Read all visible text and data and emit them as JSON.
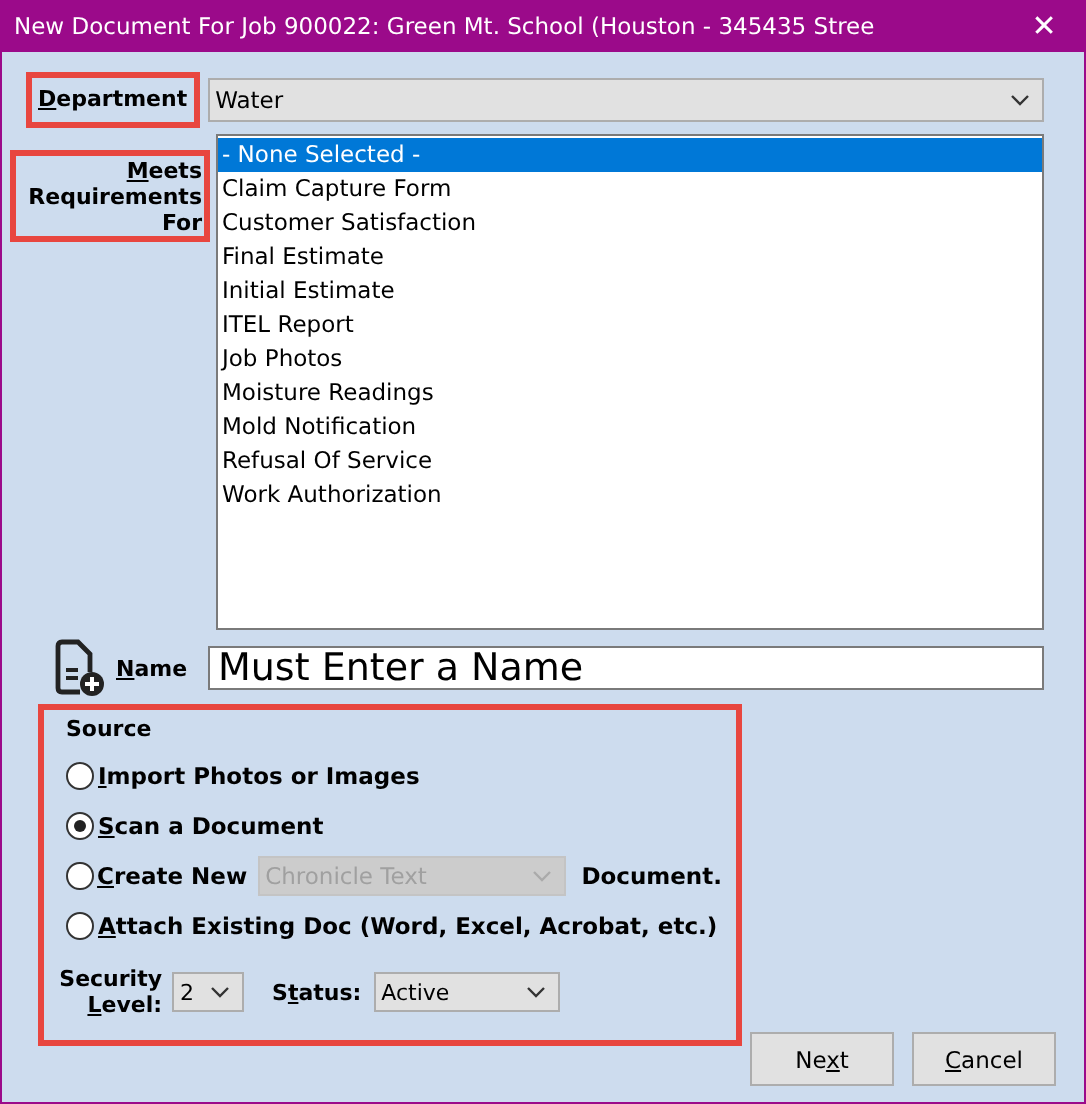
{
  "window": {
    "title": "New Document For Job 900022: Green Mt. School (Houston - 345435 Stree",
    "close": "✕"
  },
  "department": {
    "label": {
      "key": "D",
      "post": "epartment"
    },
    "highlighted": true,
    "value": "Water"
  },
  "meets_requirements": {
    "label": {
      "key": "M",
      "post": "eets Requirements For"
    },
    "highlighted": true,
    "items": [
      {
        "label": "- None Selected -",
        "selected": true
      },
      {
        "label": "Claim Capture Form",
        "selected": false
      },
      {
        "label": "Customer Satisfaction",
        "selected": false
      },
      {
        "label": "Final Estimate",
        "selected": false
      },
      {
        "label": "Initial Estimate",
        "selected": false
      },
      {
        "label": "ITEL Report",
        "selected": false
      },
      {
        "label": "Job Photos",
        "selected": false
      },
      {
        "label": "Moisture Readings",
        "selected": false
      },
      {
        "label": "Mold Notification",
        "selected": false
      },
      {
        "label": "Refusal Of Service",
        "selected": false
      },
      {
        "label": "Work Authorization",
        "selected": false
      }
    ]
  },
  "name": {
    "label": {
      "key": "N",
      "post": "ame"
    },
    "placeholder": "Must Enter a Name"
  },
  "source": {
    "title": "Source",
    "highlighted": true,
    "options": [
      {
        "kind": "plain",
        "label": {
          "key": "I",
          "post": "mport Photos or Images"
        },
        "selected": false
      },
      {
        "kind": "plain",
        "label": {
          "key": "S",
          "post": "can a Document"
        },
        "selected": true
      },
      {
        "kind": "template",
        "label": {
          "key": "C",
          "post": "reate New"
        },
        "selected": false,
        "dropdown": {
          "value": "Chronicle Text",
          "disabled": true
        },
        "suffix": "Document."
      },
      {
        "kind": "plain",
        "label": {
          "key": "A",
          "post": "ttach Existing Doc (Word, Excel, Acrobat, etc.)"
        },
        "selected": false
      }
    ],
    "security": {
      "label": {
        "pre": "Security ",
        "key": "L",
        "post": "evel:"
      },
      "value": "2"
    },
    "status": {
      "label": {
        "pre": "S",
        "key": "t",
        "post": "atus:"
      },
      "value": "Active"
    }
  },
  "buttons": [
    {
      "label": {
        "pre": "Ne",
        "key": "x",
        "post": "t"
      }
    },
    {
      "label": {
        "key": "C",
        "post": "ancel"
      }
    }
  ]
}
